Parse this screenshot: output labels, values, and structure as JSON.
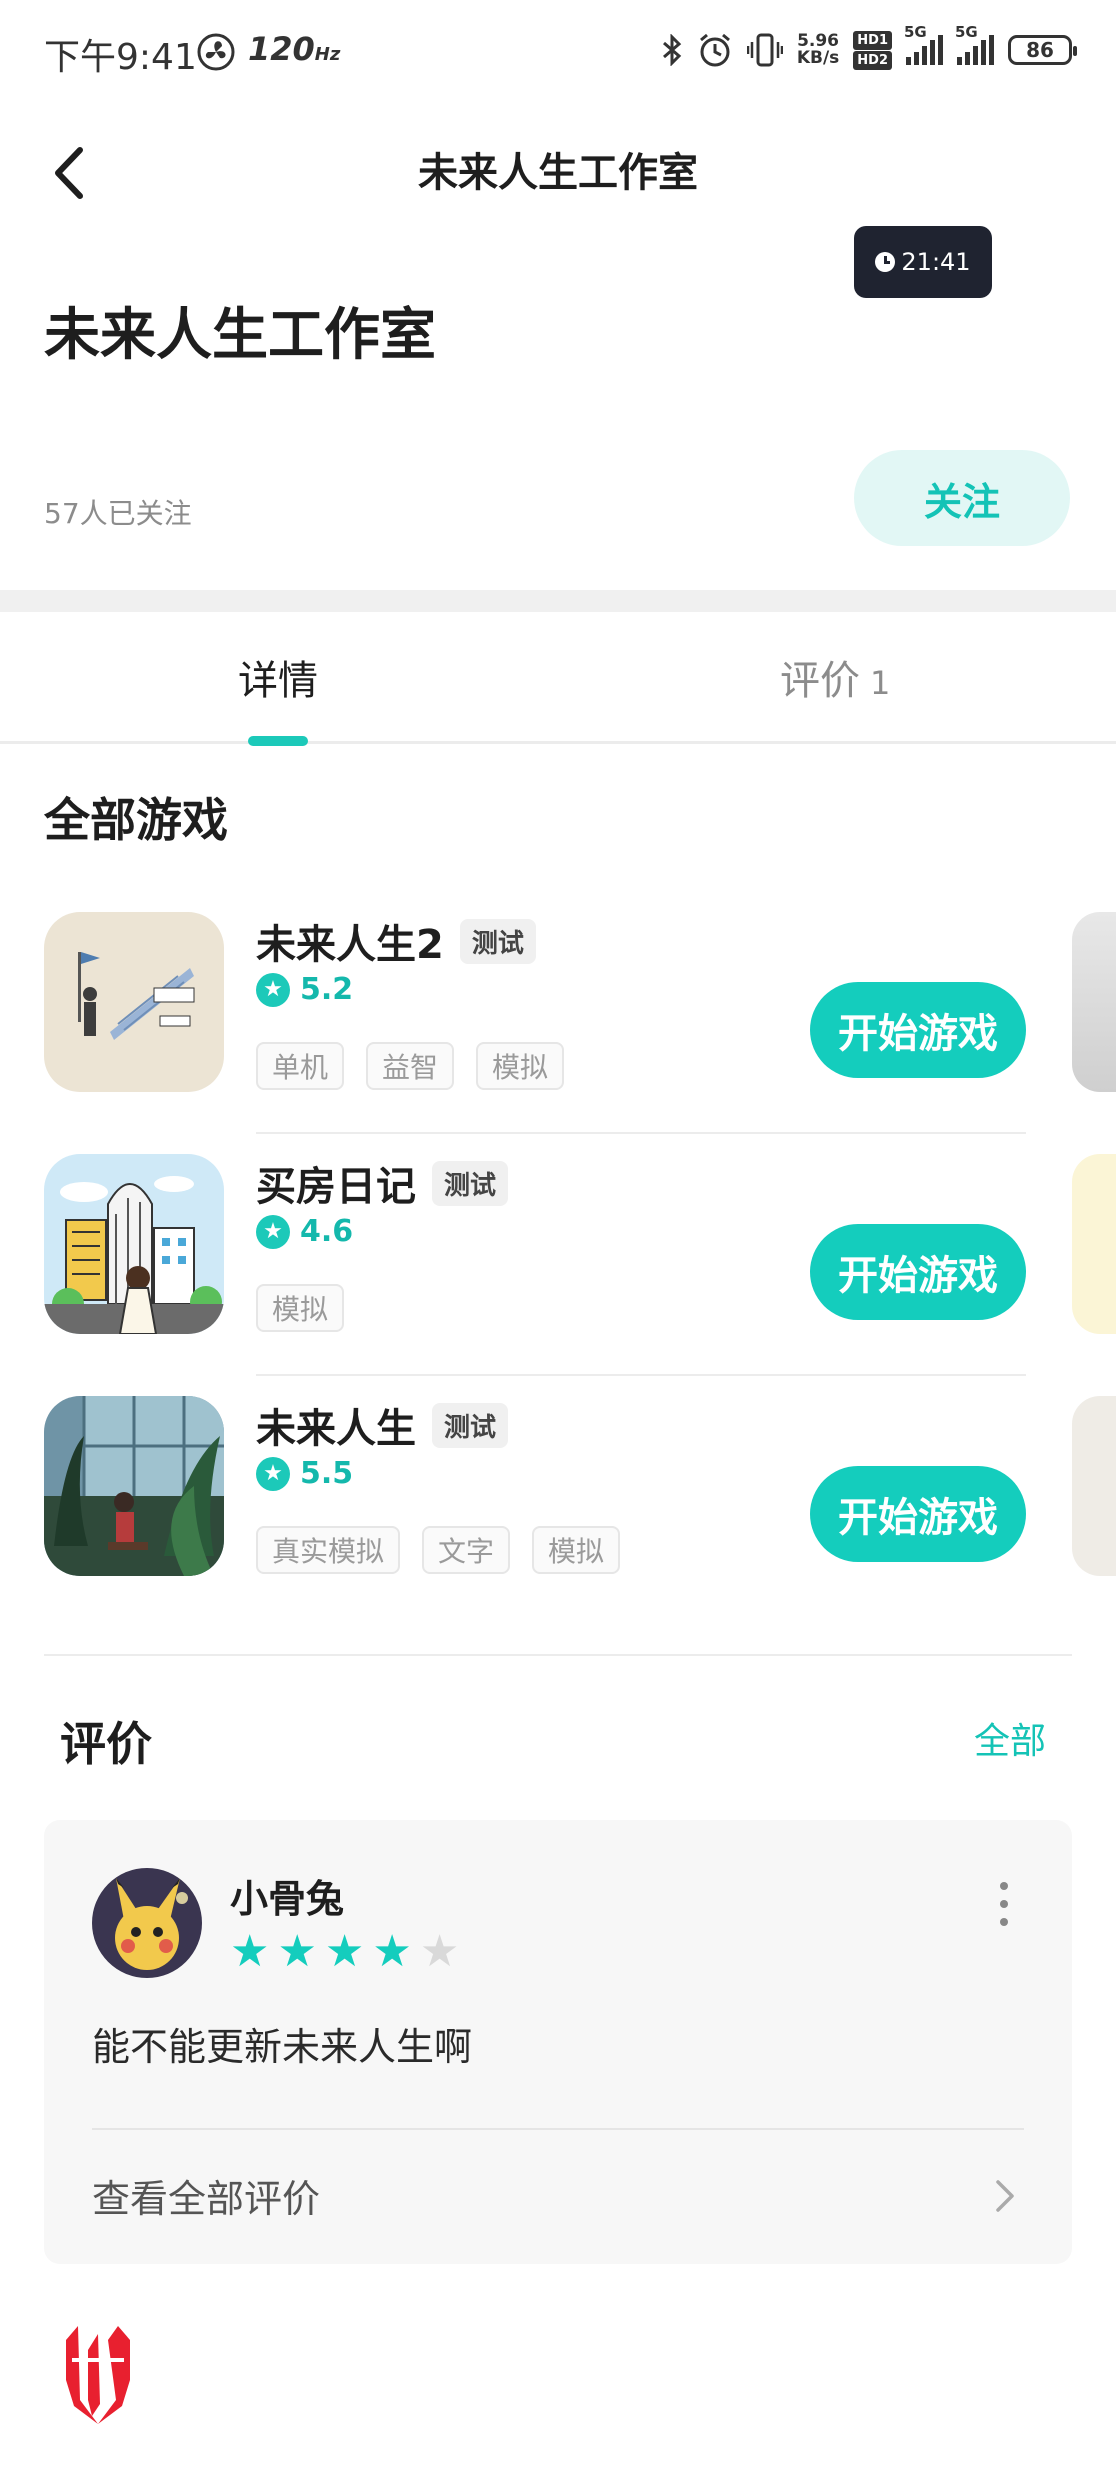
{
  "status_bar": {
    "time": "下午9:41",
    "refresh_rate": "120",
    "refresh_unit": "Hz",
    "net_speed_value": "5.96",
    "net_speed_unit": "KB/s",
    "hd1": "HD1",
    "hd2": "HD2",
    "sim1": "5G",
    "sim2": "5G",
    "battery": "86"
  },
  "header": {
    "title": "未来人生工作室",
    "back_icon": "chevron-left-icon"
  },
  "time_pill": {
    "text": "21:41"
  },
  "studio": {
    "name": "未来人生工作室",
    "followers": "57人已关注",
    "follow_label": "关注"
  },
  "tabs": [
    {
      "label": "详情",
      "active": true
    },
    {
      "label": "评价",
      "count": "1",
      "active": false
    }
  ],
  "games_section": {
    "title": "全部游戏",
    "games": [
      {
        "name": "未来人生2",
        "badge": "测试",
        "rating": "5.2",
        "tags": [
          "单机",
          "益智",
          "模拟"
        ],
        "play_label": "开始游戏"
      },
      {
        "name": "买房日记",
        "badge": "测试",
        "rating": "4.6",
        "tags": [
          "模拟"
        ],
        "play_label": "开始游戏"
      },
      {
        "name": "未来人生",
        "badge": "测试",
        "rating": "5.5",
        "tags": [
          "真实模拟",
          "文字",
          "模拟"
        ],
        "play_label": "开始游戏"
      }
    ]
  },
  "reviews": {
    "title": "评价",
    "all_label": "全部",
    "items": [
      {
        "user": "小骨兔",
        "stars": 4,
        "max_stars": 5,
        "text": "能不能更新未来人生啊"
      }
    ],
    "view_all": "查看全部评价"
  },
  "colors": {
    "accent": "#14cdbd",
    "accent_light": "#e2f7f5",
    "brand_red": "#e8202f"
  }
}
